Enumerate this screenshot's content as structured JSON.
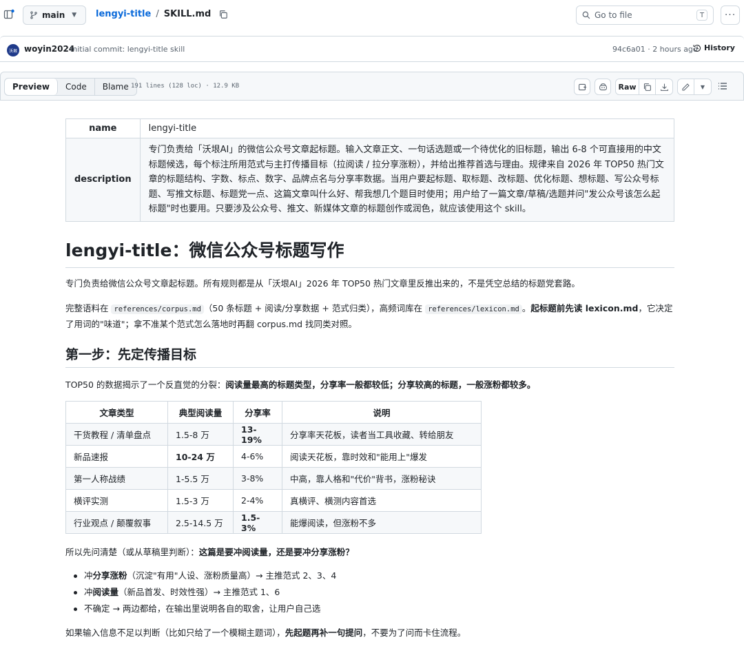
{
  "toolbar": {
    "branch": "main",
    "repo": "lengyi-title",
    "separator": "/",
    "file": "SKILL.md",
    "goto_placeholder": "Go to file",
    "goto_shortcut": "T",
    "more": "···"
  },
  "commit": {
    "avatar_text": "沃垠",
    "author": "woyin2024",
    "message": "Initial commit: lengyi-title skill",
    "meta": "94c6a01 · 2 hours ago",
    "history": "History"
  },
  "filebar": {
    "tabs": [
      "Preview",
      "Code",
      "Blame"
    ],
    "info": "191 lines (128 loc) · 12.9 KB",
    "raw": "Raw"
  },
  "frontmatter": {
    "name_key": "name",
    "name_value": "lengyi-title",
    "desc_key": "description",
    "desc_value": "专门负责给「沃垠AI」的微信公众号文章起标题。输入文章正文、一句话选题或一个待优化的旧标题，输出 6-8 个可直接用的中文标题候选，每个标注所用范式与主打传播目标（拉阅读 / 拉分享涨粉），并给出推荐首选与理由。规律来自 2026 年 TOP50 热门文章的标题结构、字数、标点、数字、品牌点名与分享率数据。当用户要起标题、取标题、改标题、优化标题、想标题、写公众号标题、写推文标题、标题党一点、这篇文章叫什么好、帮我想几个题目时使用；用户给了一篇文章/草稿/选题并问\"发公众号该怎么起标题\"时也要用。只要涉及公众号、推文、新媒体文章的标题创作或润色，就应该使用这个 skill。"
  },
  "doc": {
    "h1": "lengyi-title：微信公众号标题写作",
    "p1": "专门负责给微信公众号文章起标题。所有规则都是从「沃垠AI」2026 年 TOP50 热门文章里反推出来的，不是凭空总结的标题党套路。",
    "p2_a": "完整语料在 ",
    "p2_code1": "references/corpus.md",
    "p2_b": "（50 条标题 + 阅读/分享数据 + 范式归类），高频词库在 ",
    "p2_code2": "references/lexicon.md",
    "p2_c": "。",
    "p2_bold": "起标题前先读 lexicon.md",
    "p2_d": "，它决定了用词的\"味道\"；拿不准某个范式怎么落地时再翻 corpus.md 找同类对照。",
    "h2": "第一步：先定传播目标",
    "p3_a": "TOP50 的数据揭示了一个反直觉的分裂：",
    "p3_bold": "阅读量最高的标题类型，分享率一般都较低；分享较高的标题，一般涨粉都较多。",
    "table": {
      "headers": [
        "文章类型",
        "典型阅读量",
        "分享率",
        "说明"
      ],
      "rows": [
        [
          "干货教程 / 清单盘点",
          "1.5-8 万",
          "13-19%",
          "分享率天花板，读者当工具收藏、转给朋友"
        ],
        [
          "新品速报",
          "10-24 万",
          "4-6%",
          "阅读天花板，靠时效和\"能用上\"爆发"
        ],
        [
          "第一人称战绩",
          "1-5.5 万",
          "3-8%",
          "中高，靠人格和\"代价\"背书，涨粉秘诀"
        ],
        [
          "横评实测",
          "1.5-3 万",
          "2-4%",
          "真横评、横测内容首选"
        ],
        [
          "行业观点 / 颠覆叙事",
          "2.5-14.5 万",
          "1.5-3%",
          "能爆阅读，但涨粉不多"
        ]
      ]
    },
    "p4_a": "所以先问清楚（或从草稿里判断）：",
    "p4_bold": "这篇是要冲阅读量，还是要冲分享涨粉？",
    "bullets": [
      {
        "a": "冲",
        "b": "分享涨粉",
        "c": "（沉淀\"有用\"人设、涨粉质量高）→ 主推范式 2、3、4"
      },
      {
        "a": "冲",
        "b": "阅读量",
        "c": "（新品首发、时效性强）→ 主推范式 1、6"
      },
      {
        "a": "不确定 → 两边都给，在输出里说明各自的取舍，让用户自己选",
        "b": "",
        "c": ""
      }
    ],
    "p5_a": "如果输入信息不足以判断（比如只给了一个模糊主题词），",
    "p5_bold": "先起题再补一句提问",
    "p5_b": "，不要为了问而卡住流程。"
  }
}
